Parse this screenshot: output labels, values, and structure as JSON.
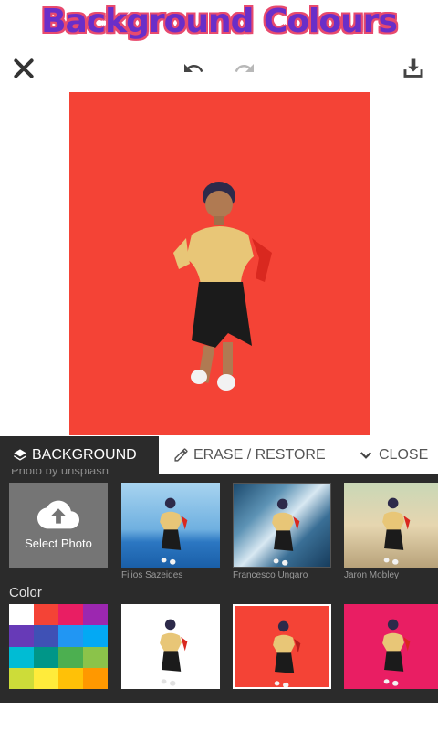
{
  "banner": {
    "title": "Background Colours"
  },
  "toolbar": {
    "close_icon": "close-icon",
    "undo_icon": "undo-icon",
    "redo_icon": "redo-icon",
    "save_icon": "download-icon"
  },
  "canvas": {
    "background_color": "#f44336"
  },
  "tabs": [
    {
      "label": "BACKGROUND",
      "icon": "layers-icon",
      "active": true
    },
    {
      "label": "ERASE / RESTORE",
      "icon": "pencil-icon",
      "active": false
    },
    {
      "label": "CLOSE",
      "icon": "chevron-down-icon",
      "active": false
    }
  ],
  "photos": {
    "section_label_partial": "Photo by unsplash",
    "select_label": "Select Photo",
    "select_icon": "cloud-upload-icon",
    "items": [
      {
        "credit": "Filios Sazeides"
      },
      {
        "credit": "Francesco Ungaro"
      },
      {
        "credit": "Jaron Mobley"
      }
    ]
  },
  "colors": {
    "section_label": "Color",
    "palette": [
      "#ffffff",
      "#f44336",
      "#e91e63",
      "#9c27b0",
      "#673ab7",
      "#3f51b5",
      "#2196f3",
      "#03a9f4",
      "#00bcd4",
      "#009688",
      "#4caf50",
      "#8bc34a",
      "#cddc39",
      "#ffeb3b",
      "#ffc107",
      "#ff9800"
    ],
    "presets": [
      {
        "color": "#ffffff"
      },
      {
        "color": "#f44336",
        "selected": true
      },
      {
        "color": "#e91e63"
      }
    ]
  }
}
